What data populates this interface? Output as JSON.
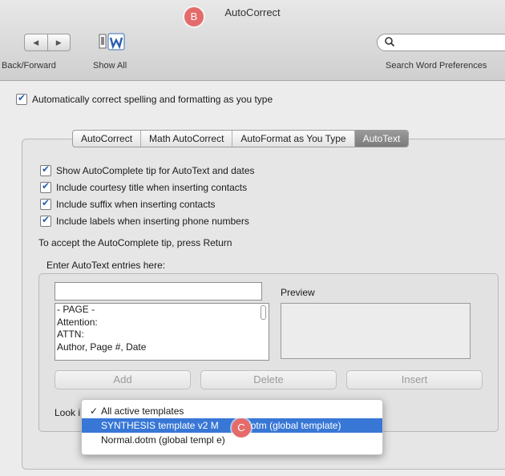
{
  "window": {
    "title": "AutoCorrect"
  },
  "markers": {
    "b": "B",
    "c": "C"
  },
  "toolbar": {
    "back_forward_label": "Back/Forward",
    "show_all_label": "Show All",
    "search_label": "Search Word Preferences",
    "search_value": ""
  },
  "master_option": {
    "label": "Automatically correct spelling and formatting as you type",
    "checked": true
  },
  "tabs": [
    {
      "label": "AutoCorrect",
      "active": false
    },
    {
      "label": "Math AutoCorrect",
      "active": false
    },
    {
      "label": "AutoFormat as You Type",
      "active": false
    },
    {
      "label": "AutoText",
      "active": true
    }
  ],
  "options": [
    {
      "label": "Show AutoComplete tip for AutoText and dates",
      "checked": true
    },
    {
      "label": "Include courtesy title when inserting contacts",
      "checked": true
    },
    {
      "label": "Include suffix when inserting contacts",
      "checked": true
    },
    {
      "label": "Include labels when inserting phone numbers",
      "checked": true
    }
  ],
  "hint": "To accept the AutoComplete tip, press Return",
  "entries": {
    "label": "Enter AutoText entries here:",
    "input_value": "",
    "items": [
      "- PAGE -",
      "Attention:",
      "ATTN:",
      "Author, Page #, Date"
    ],
    "preview_label": "Preview"
  },
  "buttons": {
    "add": "Add",
    "delete": "Delete",
    "insert": "Insert"
  },
  "look_in": {
    "label": "Look i",
    "options": [
      {
        "label": "All active templates",
        "checked": true,
        "highlighted": false
      },
      {
        "label": "SYNTHESIS template v2 M",
        "tail": "dotm (global template)",
        "checked": false,
        "highlighted": true
      },
      {
        "label": "Normal.dotm (global templ",
        "tail": "e)",
        "checked": false,
        "highlighted": false
      }
    ]
  },
  "colors": {
    "accent": "#3877d6",
    "marker": "#e56b6b",
    "checkmark": "#2a5fb0"
  }
}
